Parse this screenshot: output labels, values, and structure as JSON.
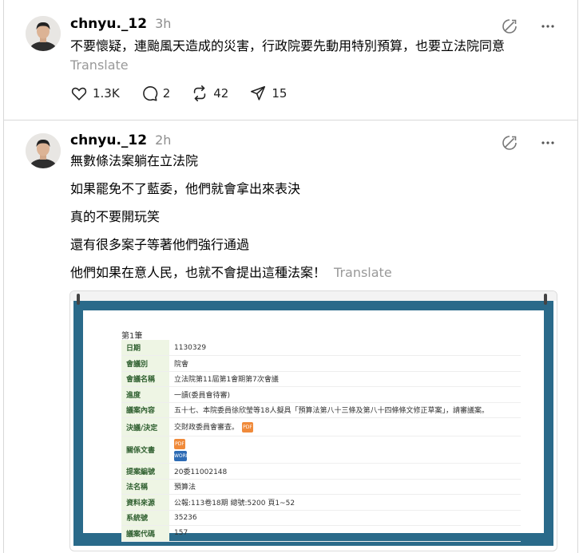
{
  "posts": [
    {
      "username": "chnyu._12",
      "time": "3h",
      "paragraphs": [
        "不要懷疑，連颱風天造成的災害，行政院要先動用特別預算，也要立法院同意"
      ],
      "translate": "Translate",
      "stats": {
        "likes": "1.3K",
        "comments": "2",
        "reposts": "42",
        "shares": "15"
      }
    },
    {
      "username": "chnyu._12",
      "time": "2h",
      "paragraphs": [
        "無數條法案躺在立法院",
        "如果罷免不了藍委，他們就會拿出來表決",
        "真的不要開玩笑",
        "還有很多案子等著他們強行通過",
        "他們如果在意人民，也就不會提出這種法案！"
      ],
      "translate": "Translate",
      "embed": {
        "title": "第1筆",
        "rows": [
          {
            "key": "日期",
            "value": "1130329"
          },
          {
            "key": "會議別",
            "value": "院會"
          },
          {
            "key": "會議名稱",
            "value": "立法院第11屆第1會期第7次會議"
          },
          {
            "key": "進度",
            "value": "一讀(委員會待審)"
          },
          {
            "key": "議案內容",
            "value": "五十七、本院委員徐欣瑩等18人擬具「預算法第八十三條及第八十四條條文修正草案」，請審議案。"
          },
          {
            "key": "決議/決定",
            "value": "交財政委員會審查。"
          },
          {
            "key": "關係文書",
            "value": ""
          },
          {
            "key": "提案編號",
            "value": "20委11002148"
          },
          {
            "key": "法名稱",
            "value": "預算法"
          },
          {
            "key": "資料來源",
            "value": "公報:113卷18期 總號:5200 頁1~52"
          },
          {
            "key": "系統號",
            "value": "35236"
          },
          {
            "key": "議案代碼",
            "value": "157"
          }
        ],
        "pdf_label": "PDF",
        "word_label": "WORD"
      }
    }
  ],
  "icons": {
    "not_interested": "not-interested-icon",
    "more": "more-icon",
    "like": "heart-icon",
    "comment": "comment-icon",
    "repost": "repost-icon",
    "share": "share-icon"
  },
  "colors": {
    "meta": "#8e8e8e",
    "translate": "#999999",
    "frame": "#2a6a8a",
    "label_bg": "#eef5e4"
  }
}
